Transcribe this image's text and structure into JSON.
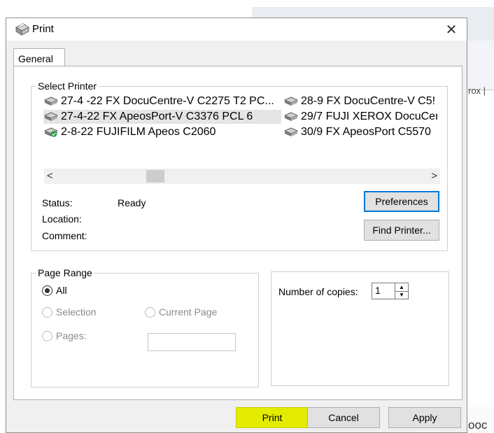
{
  "background": {
    "right_text": "rox |",
    "bottom_text": "ooc"
  },
  "dialog": {
    "title": "Print",
    "close_glyph": "✕",
    "tabs": [
      {
        "label": "General",
        "active": true
      }
    ],
    "select_printer": {
      "legend": "Select Printer",
      "printers": [
        {
          "name": "27-4 -22 FX DocuCentre-V C2275 T2 PC...",
          "selected": false,
          "default": false
        },
        {
          "name": "27-4-22 FX ApeosPort-V C3376 PCL 6",
          "selected": true,
          "default": false
        },
        {
          "name": "2-8-22 FUJIFILM Apeos C2060",
          "selected": false,
          "default": true
        },
        {
          "name": "28-9 FX DocuCentre-V C5!",
          "selected": false,
          "default": false
        },
        {
          "name": "29/7 FUJI XEROX DocuCer",
          "selected": false,
          "default": false
        },
        {
          "name": "30/9 FX ApeosPort C5570",
          "selected": false,
          "default": false
        }
      ],
      "scroll_left": "<",
      "scroll_right": ">",
      "status_label": "Status:",
      "status_value": "Ready",
      "location_label": "Location:",
      "location_value": "",
      "comment_label": "Comment:",
      "comment_value": "",
      "preferences_button": "Preferences",
      "find_printer_button": "Find Printer..."
    },
    "page_range": {
      "legend": "Page Range",
      "options": [
        {
          "label": "All",
          "checked": true,
          "enabled": true
        },
        {
          "label": "Selection",
          "checked": false,
          "enabled": false
        },
        {
          "label": "Current Page",
          "checked": false,
          "enabled": false
        },
        {
          "label": "Pages:",
          "checked": false,
          "enabled": false
        }
      ],
      "pages_value": ""
    },
    "copies": {
      "label": "Number of copies:",
      "value": "1",
      "up": "▲",
      "down": "▼"
    },
    "buttons": {
      "print": "Print",
      "cancel": "Cancel",
      "apply": "Apply"
    },
    "colors": {
      "highlight": "#e3ec00",
      "focus_border": "#0078d7",
      "selection": "#e5e5e5",
      "default_badge": "#1e9e3e"
    }
  }
}
